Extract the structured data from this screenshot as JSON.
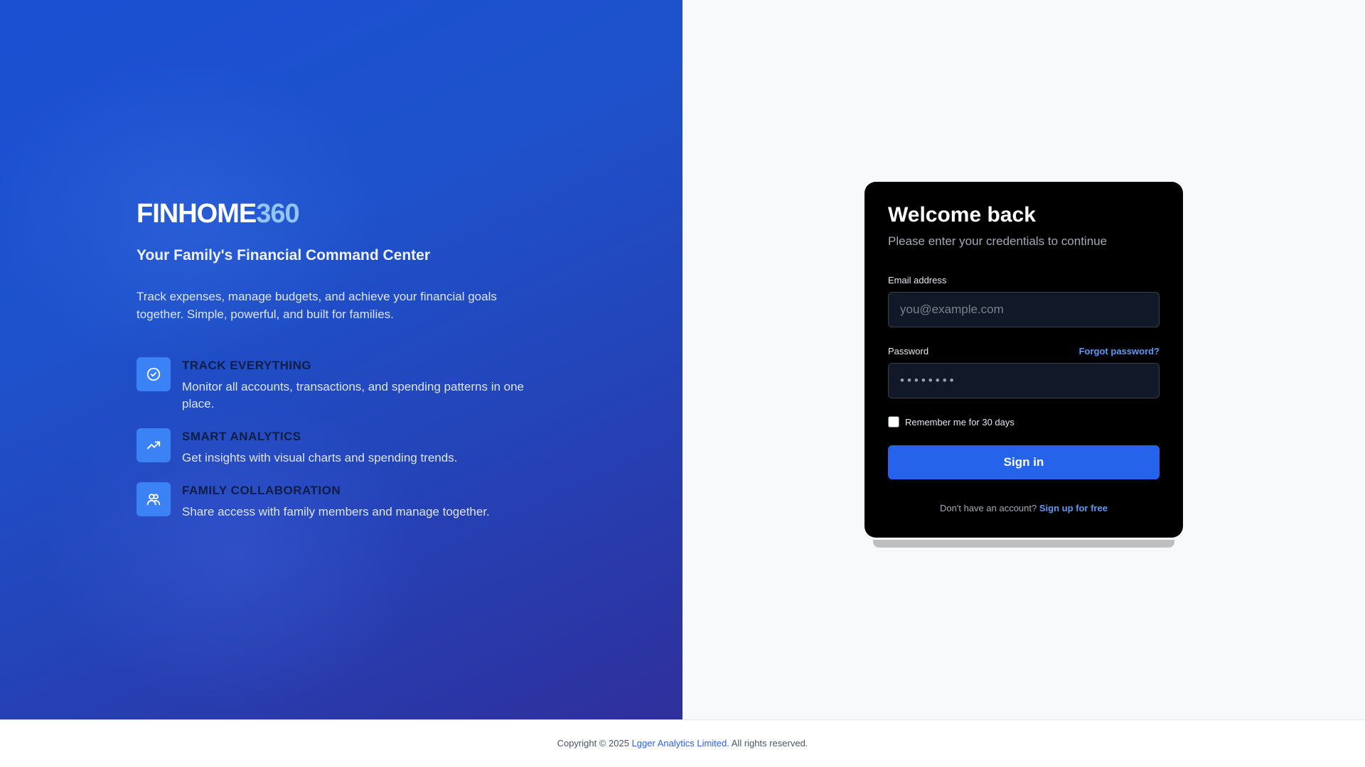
{
  "brand": {
    "name": "FINHOME",
    "accent": "360"
  },
  "hero": {
    "tagline": "Your Family's Financial Command Center",
    "description": "Track expenses, manage budgets, and achieve your financial goals together. Simple, powerful, and built for families."
  },
  "features": [
    {
      "icon": "check-circle-icon",
      "title": "TRACK EVERYTHING",
      "description": "Monitor all accounts, transactions, and spending patterns in one place."
    },
    {
      "icon": "trending-up-icon",
      "title": "SMART ANALYTICS",
      "description": "Get insights with visual charts and spending trends."
    },
    {
      "icon": "users-icon",
      "title": "FAMILY COLLABORATION",
      "description": "Share access with family members and manage together."
    }
  ],
  "login": {
    "title": "Welcome back",
    "subtitle": "Please enter your credentials to continue",
    "email_label": "Email address",
    "email_placeholder": "you@example.com",
    "password_label": "Password",
    "password_value": "••••••••",
    "forgot_link": "Forgot password?",
    "remember_label": "Remember me for 30 days",
    "remember_checked": false,
    "signin_label": "Sign in",
    "signup_prompt": "Don't have an account?",
    "signup_link": "Sign up for free"
  },
  "footer": {
    "prefix": "Copyright © 2025",
    "company": "Lgger Analytics Limited.",
    "suffix": "All rights reserved."
  },
  "colors": {
    "brand_blue": "#1d4ed8",
    "accent_light": "#93c5fd",
    "button_blue": "#2563eb",
    "card_bg": "#000000",
    "link_blue": "#5b9cf7"
  }
}
